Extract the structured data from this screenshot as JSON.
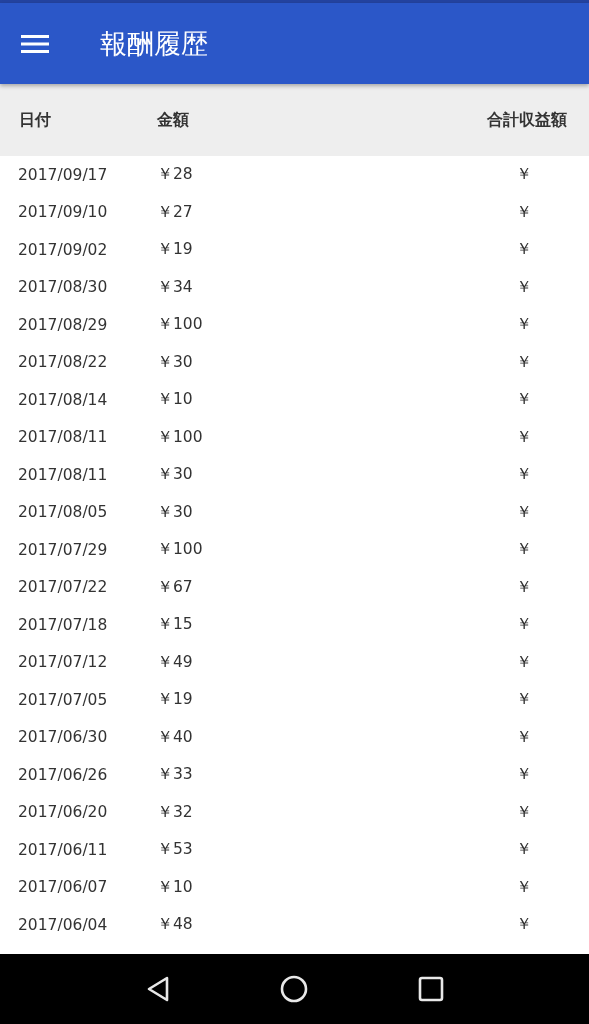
{
  "app_bar": {
    "title": "報酬履歴"
  },
  "table": {
    "columns": [
      "日付",
      "金額",
      "合計収益額"
    ],
    "rows": [
      [
        "2017/09/17",
        "￥28",
        "￥"
      ],
      [
        "2017/09/10",
        "￥27",
        "￥"
      ],
      [
        "2017/09/02",
        "￥19",
        "￥"
      ],
      [
        "2017/08/30",
        "￥34",
        "￥"
      ],
      [
        "2017/08/29",
        "￥100",
        "￥"
      ],
      [
        "2017/08/22",
        "￥30",
        "￥"
      ],
      [
        "2017/08/14",
        "￥10",
        "￥"
      ],
      [
        "2017/08/11",
        "￥100",
        "￥"
      ],
      [
        "2017/08/11",
        "￥30",
        "￥"
      ],
      [
        "2017/08/05",
        "￥30",
        "￥"
      ],
      [
        "2017/07/29",
        "￥100",
        "￥"
      ],
      [
        "2017/07/22",
        "￥67",
        "￥"
      ],
      [
        "2017/07/18",
        "￥15",
        "￥"
      ],
      [
        "2017/07/12",
        "￥49",
        "￥"
      ],
      [
        "2017/07/05",
        "￥19",
        "￥"
      ],
      [
        "2017/06/30",
        "￥40",
        "￥"
      ],
      [
        "2017/06/26",
        "￥33",
        "￥"
      ],
      [
        "2017/06/20",
        "￥32",
        "￥"
      ],
      [
        "2017/06/11",
        "￥53",
        "￥"
      ],
      [
        "2017/06/07",
        "￥10",
        "￥"
      ],
      [
        "2017/06/04",
        "￥48",
        "￥"
      ]
    ]
  }
}
